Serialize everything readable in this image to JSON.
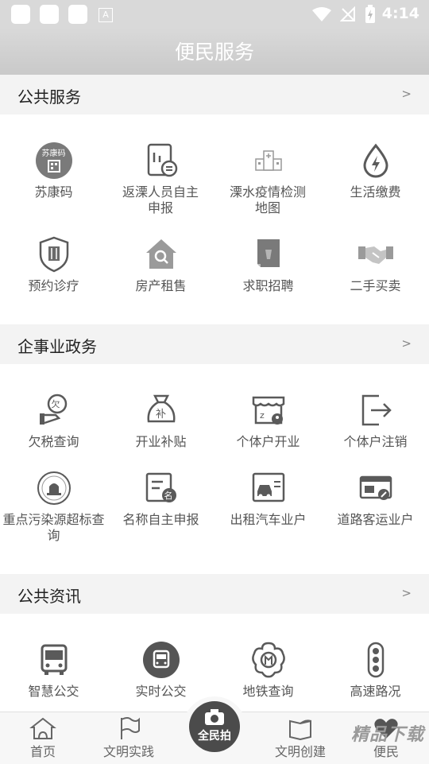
{
  "status_bar": {
    "time": "4:14"
  },
  "header": {
    "title": "便民服务"
  },
  "sections": [
    {
      "title": "公共服务",
      "arrow": ">"
    },
    {
      "title": "企事业政务",
      "arrow": ">"
    },
    {
      "title": "公共资讯",
      "arrow": ">"
    }
  ],
  "public_services": [
    {
      "label": "苏康码",
      "icon": "sukangma-icon",
      "icon_text": "苏康码"
    },
    {
      "label": "返溧人员自主申报",
      "icon": "report-form-icon"
    },
    {
      "label": "溧水疫情检测地图",
      "icon": "hospital-icon"
    },
    {
      "label": "生活缴费",
      "icon": "utility-drop-icon"
    },
    {
      "label": "预约诊疗",
      "icon": "medical-shield-icon"
    },
    {
      "label": "房产租售",
      "icon": "house-search-icon"
    },
    {
      "label": "求职招聘",
      "icon": "briefcase-icon"
    },
    {
      "label": "二手买卖",
      "icon": "handshake-icon"
    }
  ],
  "enterprise_services": [
    {
      "label": "欠税查询",
      "icon": "tax-owed-icon",
      "icon_text": "欠"
    },
    {
      "label": "开业补贴",
      "icon": "money-bag-icon",
      "icon_text": "补"
    },
    {
      "label": "个体户开业",
      "icon": "shop-icon"
    },
    {
      "label": "个体户注销",
      "icon": "exit-icon"
    },
    {
      "label": "重点污染源超标查询",
      "icon": "pollution-alarm-icon"
    },
    {
      "label": "名称自主申报",
      "icon": "name-declare-icon",
      "icon_text": "名"
    },
    {
      "label": "出租汽车业户",
      "icon": "taxi-icon"
    },
    {
      "label": "道路客运业户",
      "icon": "passenger-card-icon"
    }
  ],
  "public_info": [
    {
      "label": "智慧公交",
      "icon": "bus-icon"
    },
    {
      "label": "实时公交",
      "icon": "realtime-bus-icon"
    },
    {
      "label": "地铁查询",
      "icon": "metro-icon"
    },
    {
      "label": "高速路况",
      "icon": "traffic-light-icon"
    }
  ],
  "bottom_nav": [
    {
      "label": "首页",
      "icon": "home-icon"
    },
    {
      "label": "文明实践",
      "icon": "flag-icon"
    },
    {
      "label": "全民拍",
      "icon": "camera-icon"
    },
    {
      "label": "文明创建",
      "icon": "book-leaf-icon"
    },
    {
      "label": "便民",
      "icon": "heart-icon"
    }
  ],
  "watermark": "精品下载",
  "colors": {
    "header_bg": "#d9d9d9",
    "section_bg": "#f3f3f3",
    "icon_dark": "#5a5a5a",
    "icon_light": "#a8a8a8"
  }
}
